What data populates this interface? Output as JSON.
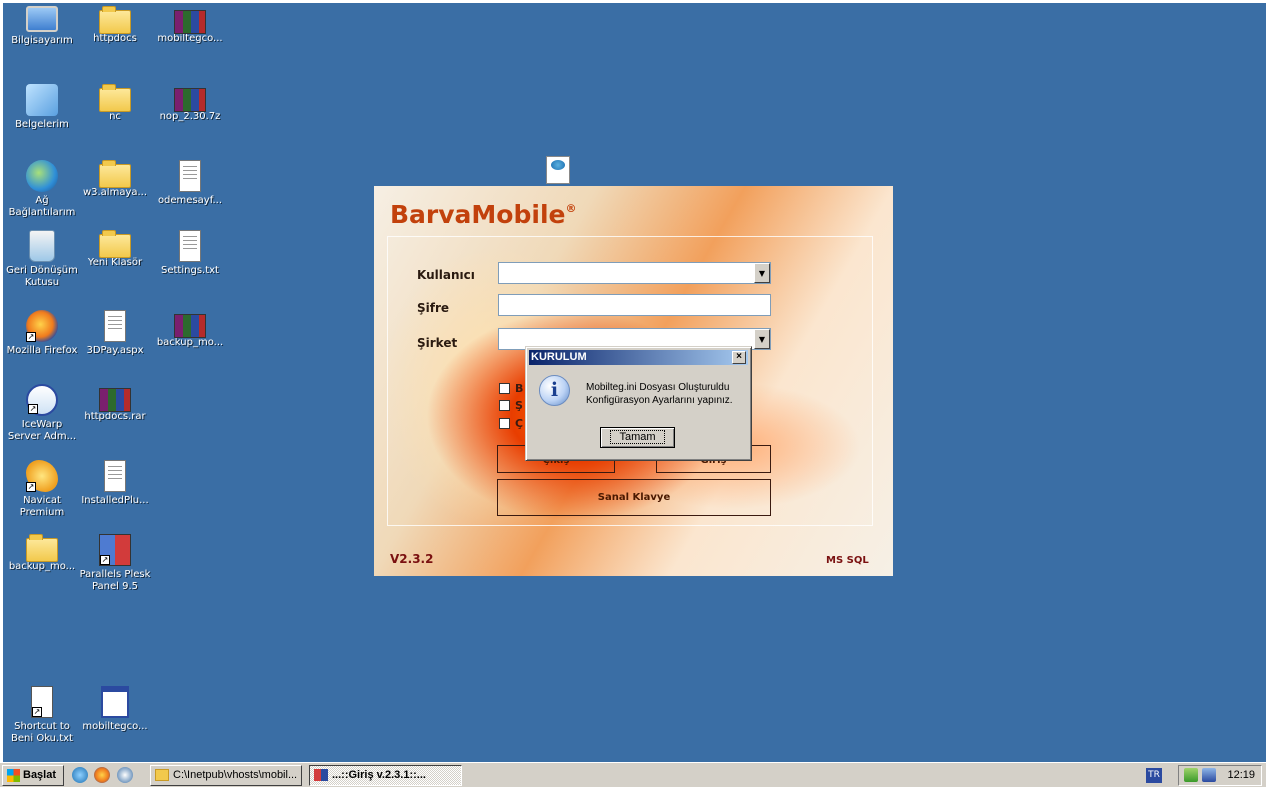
{
  "desktop": {
    "icons": [
      {
        "label": "Bilgisayarım",
        "icon": "my-computer-icon"
      },
      {
        "label": "httpdocs",
        "icon": "folder-icon"
      },
      {
        "label": "mobiltegco...",
        "icon": "rar-archive-icon"
      },
      {
        "label": "Belgelerim",
        "icon": "my-documents-icon"
      },
      {
        "label": "nc",
        "icon": "folder-icon"
      },
      {
        "label": "nop_2.30.7z",
        "icon": "rar-archive-icon"
      },
      {
        "label": "Ağ Bağlantılarım",
        "icon": "network-icon"
      },
      {
        "label": "w3.almaya...",
        "icon": "folder-icon"
      },
      {
        "label": "odemesayf...",
        "icon": "text-file-icon"
      },
      {
        "label": "Geri Dönüşüm Kutusu",
        "icon": "recycle-bin-icon"
      },
      {
        "label": "Yeni Klasör",
        "icon": "folder-icon"
      },
      {
        "label": "Settings.txt",
        "icon": "text-file-icon"
      },
      {
        "label": "Mozilla Firefox",
        "icon": "firefox-icon"
      },
      {
        "label": "3DPay.aspx",
        "icon": "text-file-icon"
      },
      {
        "label": "backup_mo...",
        "icon": "rar-archive-icon"
      },
      {
        "label": "IceWarp Server Adm...",
        "icon": "icewarp-icon"
      },
      {
        "label": "httpdocs.rar",
        "icon": "rar-archive-icon"
      },
      {
        "label": "Navicat Premium",
        "icon": "navicat-icon"
      },
      {
        "label": "InstalledPlu...",
        "icon": "text-file-icon"
      },
      {
        "label": "backup_mo...",
        "icon": "folder-icon"
      },
      {
        "label": "Parallels Plesk Panel 9.5",
        "icon": "plesk-icon"
      },
      {
        "label": "Shortcut to Beni Oku.txt",
        "icon": "shortcut-text-icon"
      },
      {
        "label": "mobiltegco...",
        "icon": "exe-icon"
      }
    ]
  },
  "login": {
    "brand": "BarvaMobile",
    "brand_mark": "®",
    "labels": {
      "user": "Kullanıcı",
      "password": "Şifre",
      "company": "Şirket"
    },
    "values": {
      "user": "",
      "password": "",
      "company": ""
    },
    "checkbox_letters": [
      "B",
      "Ş",
      "Ç"
    ],
    "buttons": {
      "left": "Çıkış",
      "right": "Giriş",
      "keyboard": "Sanal Klavye"
    },
    "version": "V2.3.2",
    "db": "MS SQL"
  },
  "msgbox": {
    "title": "KURULUM",
    "close": "×",
    "icon": "info-icon",
    "line1": "Mobilteg.ini Dosyası Oluşturuldu",
    "line2": "Konfigürasyon Ayarlarını yapınız.",
    "ok": "Tamam"
  },
  "taskbar": {
    "start": "Başlat",
    "tasks": [
      "C:\\Inetpub\\vhosts\\mobil...",
      "...::Giriş v.2.3.1::..."
    ],
    "lang": "TR",
    "clock": "12:19"
  }
}
